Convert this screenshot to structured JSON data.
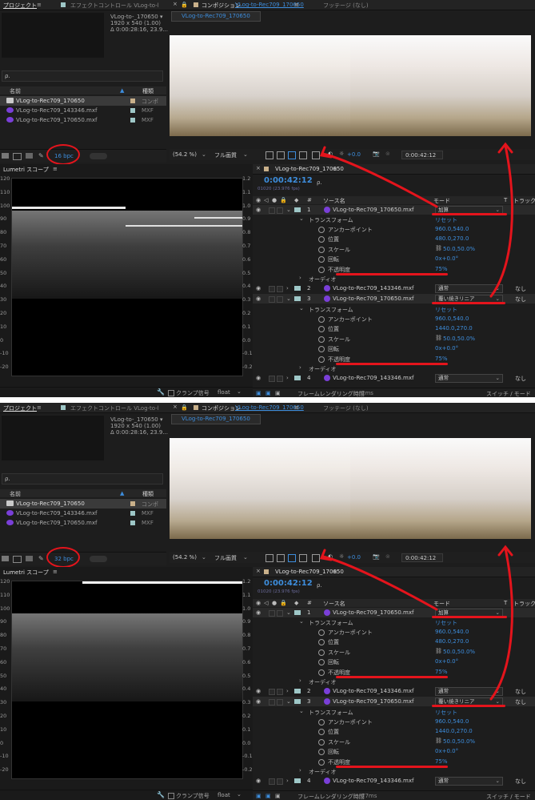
{
  "project": {
    "tab": "プロジェクト",
    "effect_tab": "エフェクトコントロール VLog-to-l",
    "thumb_name": "VLog-to-_170650 ▾",
    "thumb_size": "1920 x 540 (1.00)",
    "thumb_duration": "Δ 0:00:28:16, 23.9...",
    "search_placeholder": "ρ.",
    "col_name": "名前",
    "col_type": "種類",
    "items": [
      {
        "name": "VLog-to-Rec709_170650",
        "type": "コンポ"
      },
      {
        "name": "VLog-to-Rec709_143346.mxf",
        "type": "MXF"
      },
      {
        "name": "VLog-to-Rec709_170650.mxf",
        "type": "MXF"
      }
    ]
  },
  "composition": {
    "tab": "コンポジション",
    "tab_name": "VLog-to-Rec709_170650",
    "footage_tab": "フッテージ (なし)",
    "subtab": "VLog-to-Rec709_170650",
    "zoom": "(54.2 %)",
    "quality": "フル画質",
    "exposure": "+0.0",
    "timecode": "0:00:42:12"
  },
  "lumetri": {
    "title": "Lumetri スコープ",
    "clamp": "クランプ信号",
    "mode": "float"
  },
  "timeline": {
    "tab": "VLog-to-Rec709_170650",
    "timecode": "0:00:42:12",
    "fps": "01020 (23.976 fps)",
    "col_source": "ソース名",
    "col_mode": "モード",
    "col_t": "T",
    "col_track": "トラックマ",
    "transform": "トランスフォーム",
    "reset": "リセット",
    "audio": "オーディオ",
    "none": "なし",
    "props": {
      "anchor": "アンカーポイント",
      "position": "位置",
      "scale": "スケール",
      "rotation": "回転",
      "opacity": "不透明度"
    },
    "layer1": {
      "num": "1",
      "name": "VLog-to-Rec709_170650.mxf",
      "mode": "加算",
      "anchor": "960.0,540.0",
      "position": "480.0,270.0",
      "scale": "50.0,50.0%",
      "rotation": "0x+0.0°",
      "opacity": "75%"
    },
    "layer2": {
      "num": "2",
      "name": "VLog-to-Rec709_143346.mxf",
      "mode": "通常"
    },
    "layer3": {
      "num": "3",
      "name": "VLog-to-Rec709_170650.mxf",
      "mode": "覆い焼きリニア",
      "anchor": "960.0,540.0",
      "position": "1440.0,270.0",
      "scale": "50.0,50.0%",
      "rotation": "0x+0.0°",
      "opacity": "75%"
    },
    "layer4": {
      "num": "4",
      "name": "VLog-to-Rec709_143346.mxf",
      "mode": "通常"
    },
    "footer": "フレームレンダリング時間",
    "switch_mode": "スイッチ / モード"
  },
  "snapshots": [
    {
      "bpc": "16 bpc",
      "render_time": "2ms"
    },
    {
      "bpc": "32 bpc",
      "render_time": "77ms"
    }
  ],
  "scope_ticks_left": [
    "120",
    "110",
    "100",
    "90",
    "80",
    "70",
    "60",
    "50",
    "40",
    "30",
    "20",
    "10",
    "0",
    "-10",
    "-20"
  ],
  "scope_ticks_right": [
    "1.2",
    "1.1",
    "1.0",
    "0.9",
    "0.8",
    "0.7",
    "0.6",
    "0.5",
    "0.4",
    "0.3",
    "0.2",
    "0.1",
    "0.0",
    "-0.1",
    "-0.2"
  ],
  "colors": {
    "accent": "#3d8ddc",
    "annotation": "#e4141c",
    "layer_icon": "#7a3fd8",
    "panel": "#1d1d1d"
  }
}
